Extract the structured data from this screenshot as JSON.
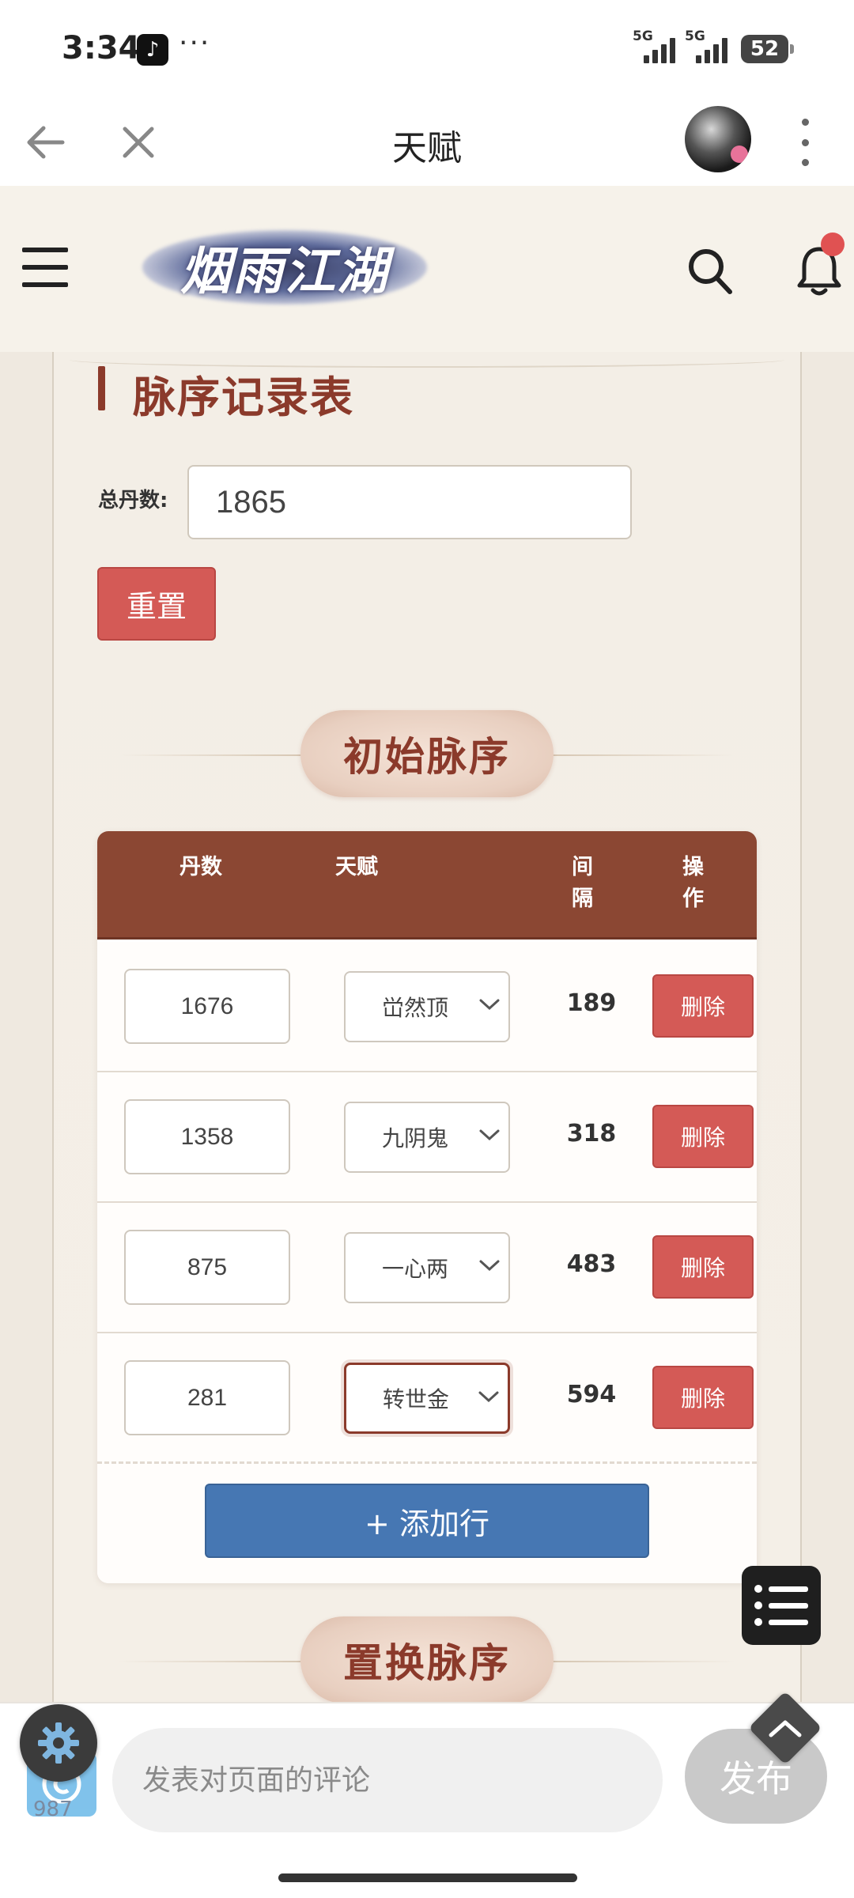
{
  "status_bar": {
    "time": "3:34",
    "app_icon": "tiktok-icon",
    "more": "···",
    "signal_1_label": "5G",
    "signal_2_label": "5G",
    "battery": "52"
  },
  "browser": {
    "title": "天赋"
  },
  "site": {
    "logo_text": "烟雨江湖",
    "notification_dot_color": "#e05252"
  },
  "section": {
    "title": "脉序记录表",
    "total_label": "总丹数:",
    "total_value": "1865",
    "reset_label": "重置",
    "initial_title": "初始脉序",
    "replace_title": "置换脉序"
  },
  "table": {
    "headers": {
      "dan": "丹数",
      "talent": "天赋",
      "gap": "间隔",
      "op": "操作"
    },
    "rows": [
      {
        "dan": "1676",
        "talent": "峃然顶",
        "gap": "189",
        "delete": "删除"
      },
      {
        "dan": "1358",
        "talent": "九阴鬼",
        "gap": "318",
        "delete": "删除"
      },
      {
        "dan": "875",
        "talent": "一心两",
        "gap": "483",
        "delete": "删除"
      },
      {
        "dan": "281",
        "talent": "转世金",
        "gap": "594",
        "delete": "删除"
      }
    ],
    "add_label": "+ 添加行"
  },
  "bottom": {
    "comment_placeholder": "发表对页面的评论",
    "publish_label": "发布",
    "badge_count": "987"
  },
  "colors": {
    "accent": "#8b3a2b",
    "danger": "#d45a56",
    "primary": "#4677b3",
    "header_bg": "#8b4733"
  }
}
